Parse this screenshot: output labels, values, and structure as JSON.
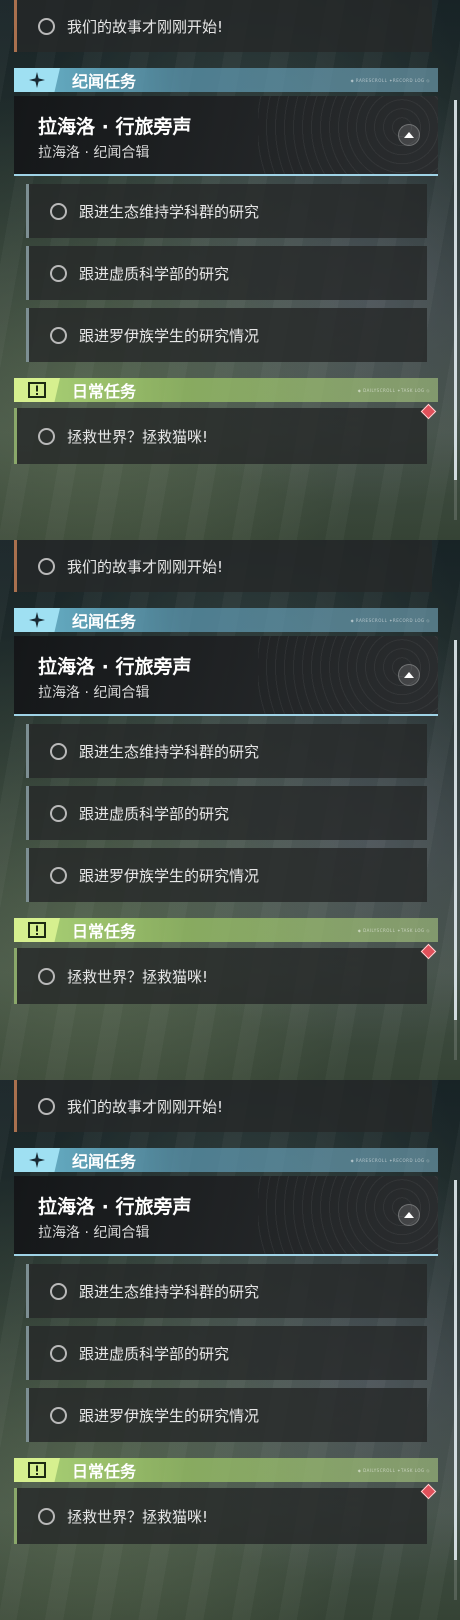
{
  "panels": [
    {
      "top_quest": "我们的故事才刚刚开始!",
      "story_category": {
        "label": "纪闻任务",
        "tiny": "◆ RARESCROLL ✦RECORD LOG ◇"
      },
      "group": {
        "title": "拉海洛 · 行旅旁声",
        "subtitle": "拉海洛 · 纪闻合辑"
      },
      "sub_quests": [
        "跟进生态维持学科群的研究",
        "跟进虚质科学部的研究",
        "跟进罗伊族学生的研究情况"
      ],
      "daily_category": {
        "label": "日常任务",
        "tiny": "◆ DAILYSCROLL ✦TASK LOG ◇"
      },
      "daily_quest": "拯救世界？拯救猫咪!"
    },
    {
      "top_quest": "我们的故事才刚刚开始!",
      "story_category": {
        "label": "纪闻任务",
        "tiny": "◆ RARESCROLL ✦RECORD LOG ◇"
      },
      "group": {
        "title": "拉海洛 · 行旅旁声",
        "subtitle": "拉海洛 · 纪闻合辑"
      },
      "sub_quests": [
        "跟进生态维持学科群的研究",
        "跟进虚质科学部的研究",
        "跟进罗伊族学生的研究情况"
      ],
      "daily_category": {
        "label": "日常任务",
        "tiny": "◆ DAILYSCROLL ✦TASK LOG ◇"
      },
      "daily_quest": "拯救世界？拯救猫咪!"
    },
    {
      "top_quest": "我们的故事才刚刚开始!",
      "story_category": {
        "label": "纪闻任务",
        "tiny": "◆ RARESCROLL ✦RECORD LOG ◇"
      },
      "group": {
        "title": "拉海洛 · 行旅旁声",
        "subtitle": "拉海洛 · 纪闻合辑"
      },
      "sub_quests": [
        "跟进生态维持学科群的研究",
        "跟进虚质科学部的研究",
        "跟进罗伊族学生的研究情况"
      ],
      "daily_category": {
        "label": "日常任务",
        "tiny": "◆ DAILYSCROLL ✦TASK LOG ◇"
      },
      "daily_quest": "拯救世界？拯救猫咪!"
    }
  ],
  "icons": {
    "story": "sparkle-icon",
    "daily": "exclamation-icon",
    "collapse": "chevron-up-icon",
    "tracked": "diamond-marker-icon",
    "status": "circle-outline-icon"
  },
  "colors": {
    "story_accent": "#9fe0f2",
    "daily_accent": "#d6f08f",
    "marker": "#e0505a"
  }
}
